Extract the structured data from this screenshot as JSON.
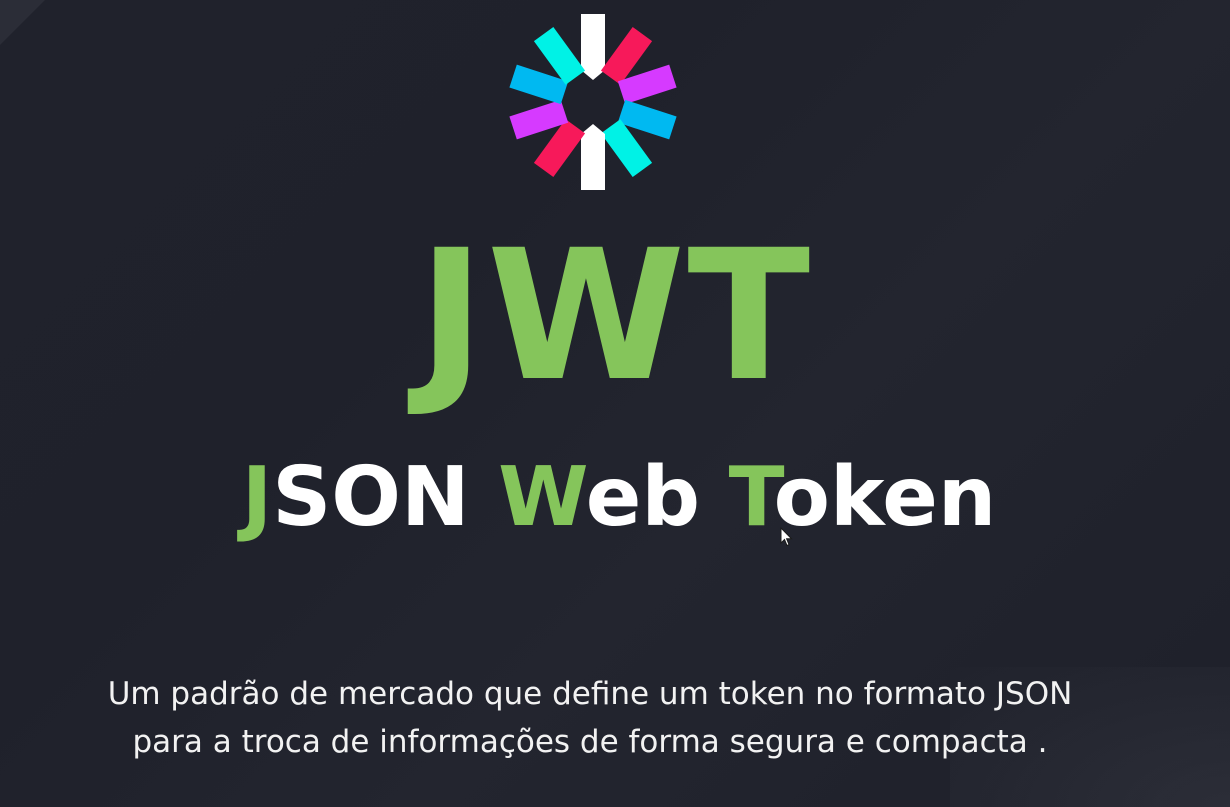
{
  "slide": {
    "title": "JWT",
    "subtitle": {
      "word1_initial": "J",
      "word1_rest": "SON",
      "word2_initial": "W",
      "word2_rest": "eb",
      "word3_initial": "T",
      "word3_rest": "oken"
    },
    "description": {
      "line1": "Um padrão de mercado que define um token no formato JSON",
      "line2": "para a troca de informações de forma segura e compacta ."
    }
  },
  "icons": {
    "logo": "jwt-logo-icon",
    "cursor": "mouse-pointer-icon"
  },
  "colors": {
    "background": "#20222c",
    "accent_green": "#85c55b",
    "text_white": "#ffffff",
    "logo_white": "#ffffff",
    "logo_pink": "#f7195a",
    "logo_magenta": "#d63aff",
    "logo_blue": "#00b9f1",
    "logo_cyan": "#00f2e6"
  }
}
